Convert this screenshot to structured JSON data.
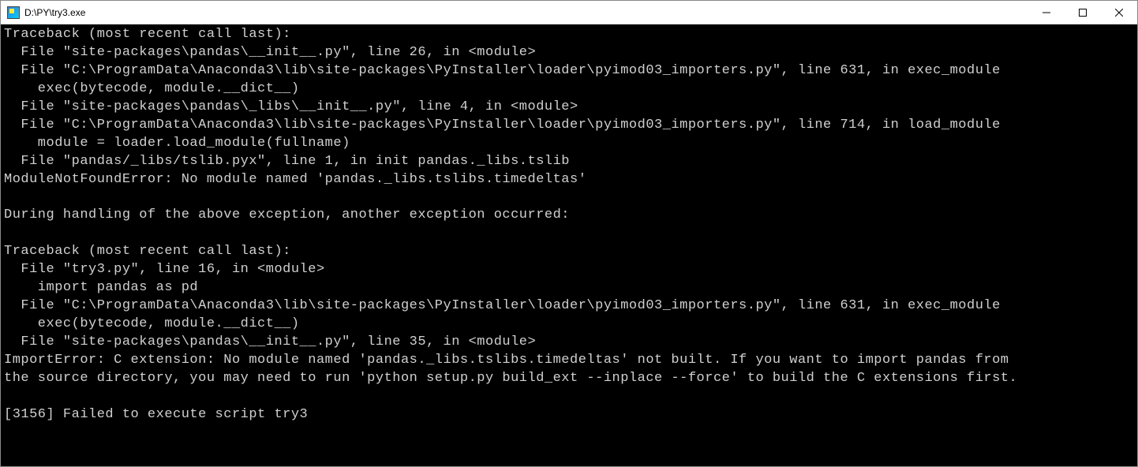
{
  "window": {
    "title": "D:\\PY\\try3.exe"
  },
  "terminal": {
    "lines": [
      "Traceback (most recent call last):",
      "  File \"site-packages\\pandas\\__init__.py\", line 26, in <module>",
      "  File \"C:\\ProgramData\\Anaconda3\\lib\\site-packages\\PyInstaller\\loader\\pyimod03_importers.py\", line 631, in exec_module",
      "    exec(bytecode, module.__dict__)",
      "  File \"site-packages\\pandas\\_libs\\__init__.py\", line 4, in <module>",
      "  File \"C:\\ProgramData\\Anaconda3\\lib\\site-packages\\PyInstaller\\loader\\pyimod03_importers.py\", line 714, in load_module",
      "    module = loader.load_module(fullname)",
      "  File \"pandas/_libs/tslib.pyx\", line 1, in init pandas._libs.tslib",
      "ModuleNotFoundError: No module named 'pandas._libs.tslibs.timedeltas'",
      "",
      "During handling of the above exception, another exception occurred:",
      "",
      "Traceback (most recent call last):",
      "  File \"try3.py\", line 16, in <module>",
      "    import pandas as pd",
      "  File \"C:\\ProgramData\\Anaconda3\\lib\\site-packages\\PyInstaller\\loader\\pyimod03_importers.py\", line 631, in exec_module",
      "    exec(bytecode, module.__dict__)",
      "  File \"site-packages\\pandas\\__init__.py\", line 35, in <module>",
      "ImportError: C extension: No module named 'pandas._libs.tslibs.timedeltas' not built. If you want to import pandas from",
      "the source directory, you may need to run 'python setup.py build_ext --inplace --force' to build the C extensions first.",
      "",
      "[3156] Failed to execute script try3"
    ]
  }
}
